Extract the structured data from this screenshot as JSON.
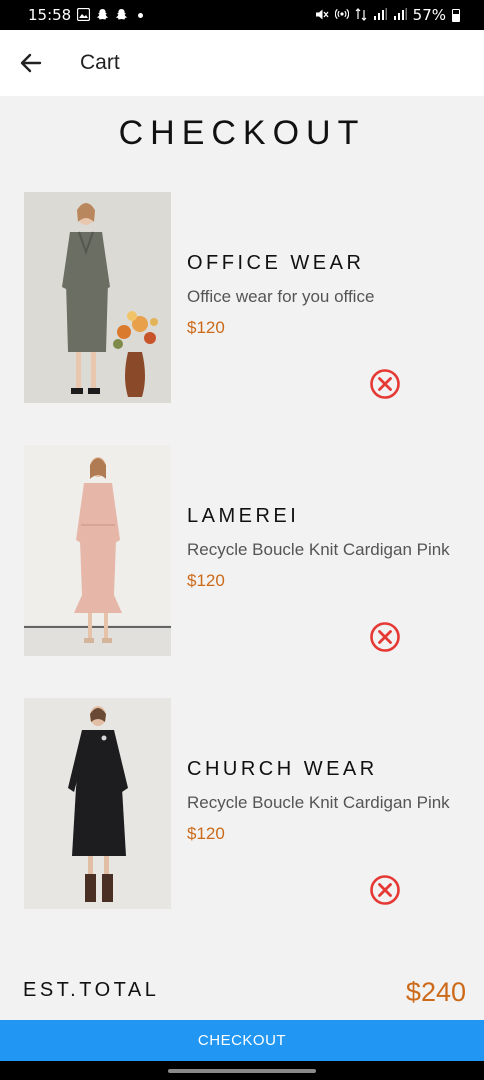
{
  "status_bar": {
    "time": "15:58",
    "battery": "57%",
    "icons": [
      "image-icon",
      "snapchat-icon",
      "snapchat-icon",
      "dot-icon",
      "mute-icon",
      "hotspot-icon",
      "data-icon",
      "signal-icon",
      "signal-icon",
      "battery-icon"
    ]
  },
  "app_bar": {
    "back_icon": "arrow-left-icon",
    "title": "Cart"
  },
  "page": {
    "title": "CHECKOUT"
  },
  "items": [
    {
      "name": "OFFICE WEAR",
      "description": "Office wear for you office",
      "price": "$120",
      "image": "olive tweed suit dress with flowers",
      "remove_icon": "remove-circle-icon"
    },
    {
      "name": "LAMEREI",
      "description": "Recycle Boucle Knit Cardigan Pink",
      "price": "$120",
      "image": "pink knit midi dress",
      "remove_icon": "remove-circle-icon"
    },
    {
      "name": "CHURCH WEAR",
      "description": "Recycle Boucle Knit Cardigan Pink",
      "price": "$120",
      "image": "black long sleeve dress",
      "remove_icon": "remove-circle-icon"
    }
  ],
  "total": {
    "label": "EST.TOTAL",
    "value": "$240"
  },
  "checkout_button": {
    "label": "CHECKOUT"
  },
  "colors": {
    "accent": "#2196f3",
    "price": "#cc6a1a",
    "remove": "#e53935",
    "background": "#f2f2f2"
  }
}
